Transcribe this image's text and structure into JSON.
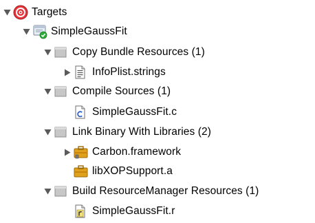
{
  "tree": {
    "targets": {
      "label": "Targets",
      "icon": "target-icon",
      "expanded": true
    },
    "target": {
      "label": "SimpleGaussFit",
      "icon": "application-target-icon",
      "expanded": true
    },
    "phases": [
      {
        "label": "Copy Bundle Resources (1)",
        "icon": "build-phase-folder-icon",
        "expanded": true,
        "children": [
          {
            "label": "InfoPlist.strings",
            "icon": "strings-file-icon",
            "expandable": true,
            "expanded": false
          }
        ]
      },
      {
        "label": "Compile Sources (1)",
        "icon": "build-phase-folder-icon",
        "expanded": true,
        "children": [
          {
            "label": "SimpleGaussFit.c",
            "icon": "c-source-file-icon",
            "expandable": false
          }
        ]
      },
      {
        "label": "Link Binary With Libraries (2)",
        "icon": "build-phase-folder-icon",
        "expanded": true,
        "children": [
          {
            "label": "Carbon.framework",
            "icon": "framework-icon",
            "expandable": true,
            "expanded": false
          },
          {
            "label": "libXOPSupport.a",
            "icon": "static-library-icon",
            "expandable": false
          }
        ]
      },
      {
        "label": "Build ResourceManager Resources (1)",
        "icon": "build-phase-folder-icon",
        "expanded": true,
        "children": [
          {
            "label": "SimpleGaussFit.r",
            "icon": "rez-file-icon",
            "expandable": false
          }
        ]
      }
    ]
  },
  "colors": {
    "disclosure": "#5a5a5a",
    "target_red": "#e5343a",
    "folder_gray": "#b3b3b3",
    "framework_gold": "#e0a21c",
    "c_file_blue": "#2f5fc8"
  }
}
